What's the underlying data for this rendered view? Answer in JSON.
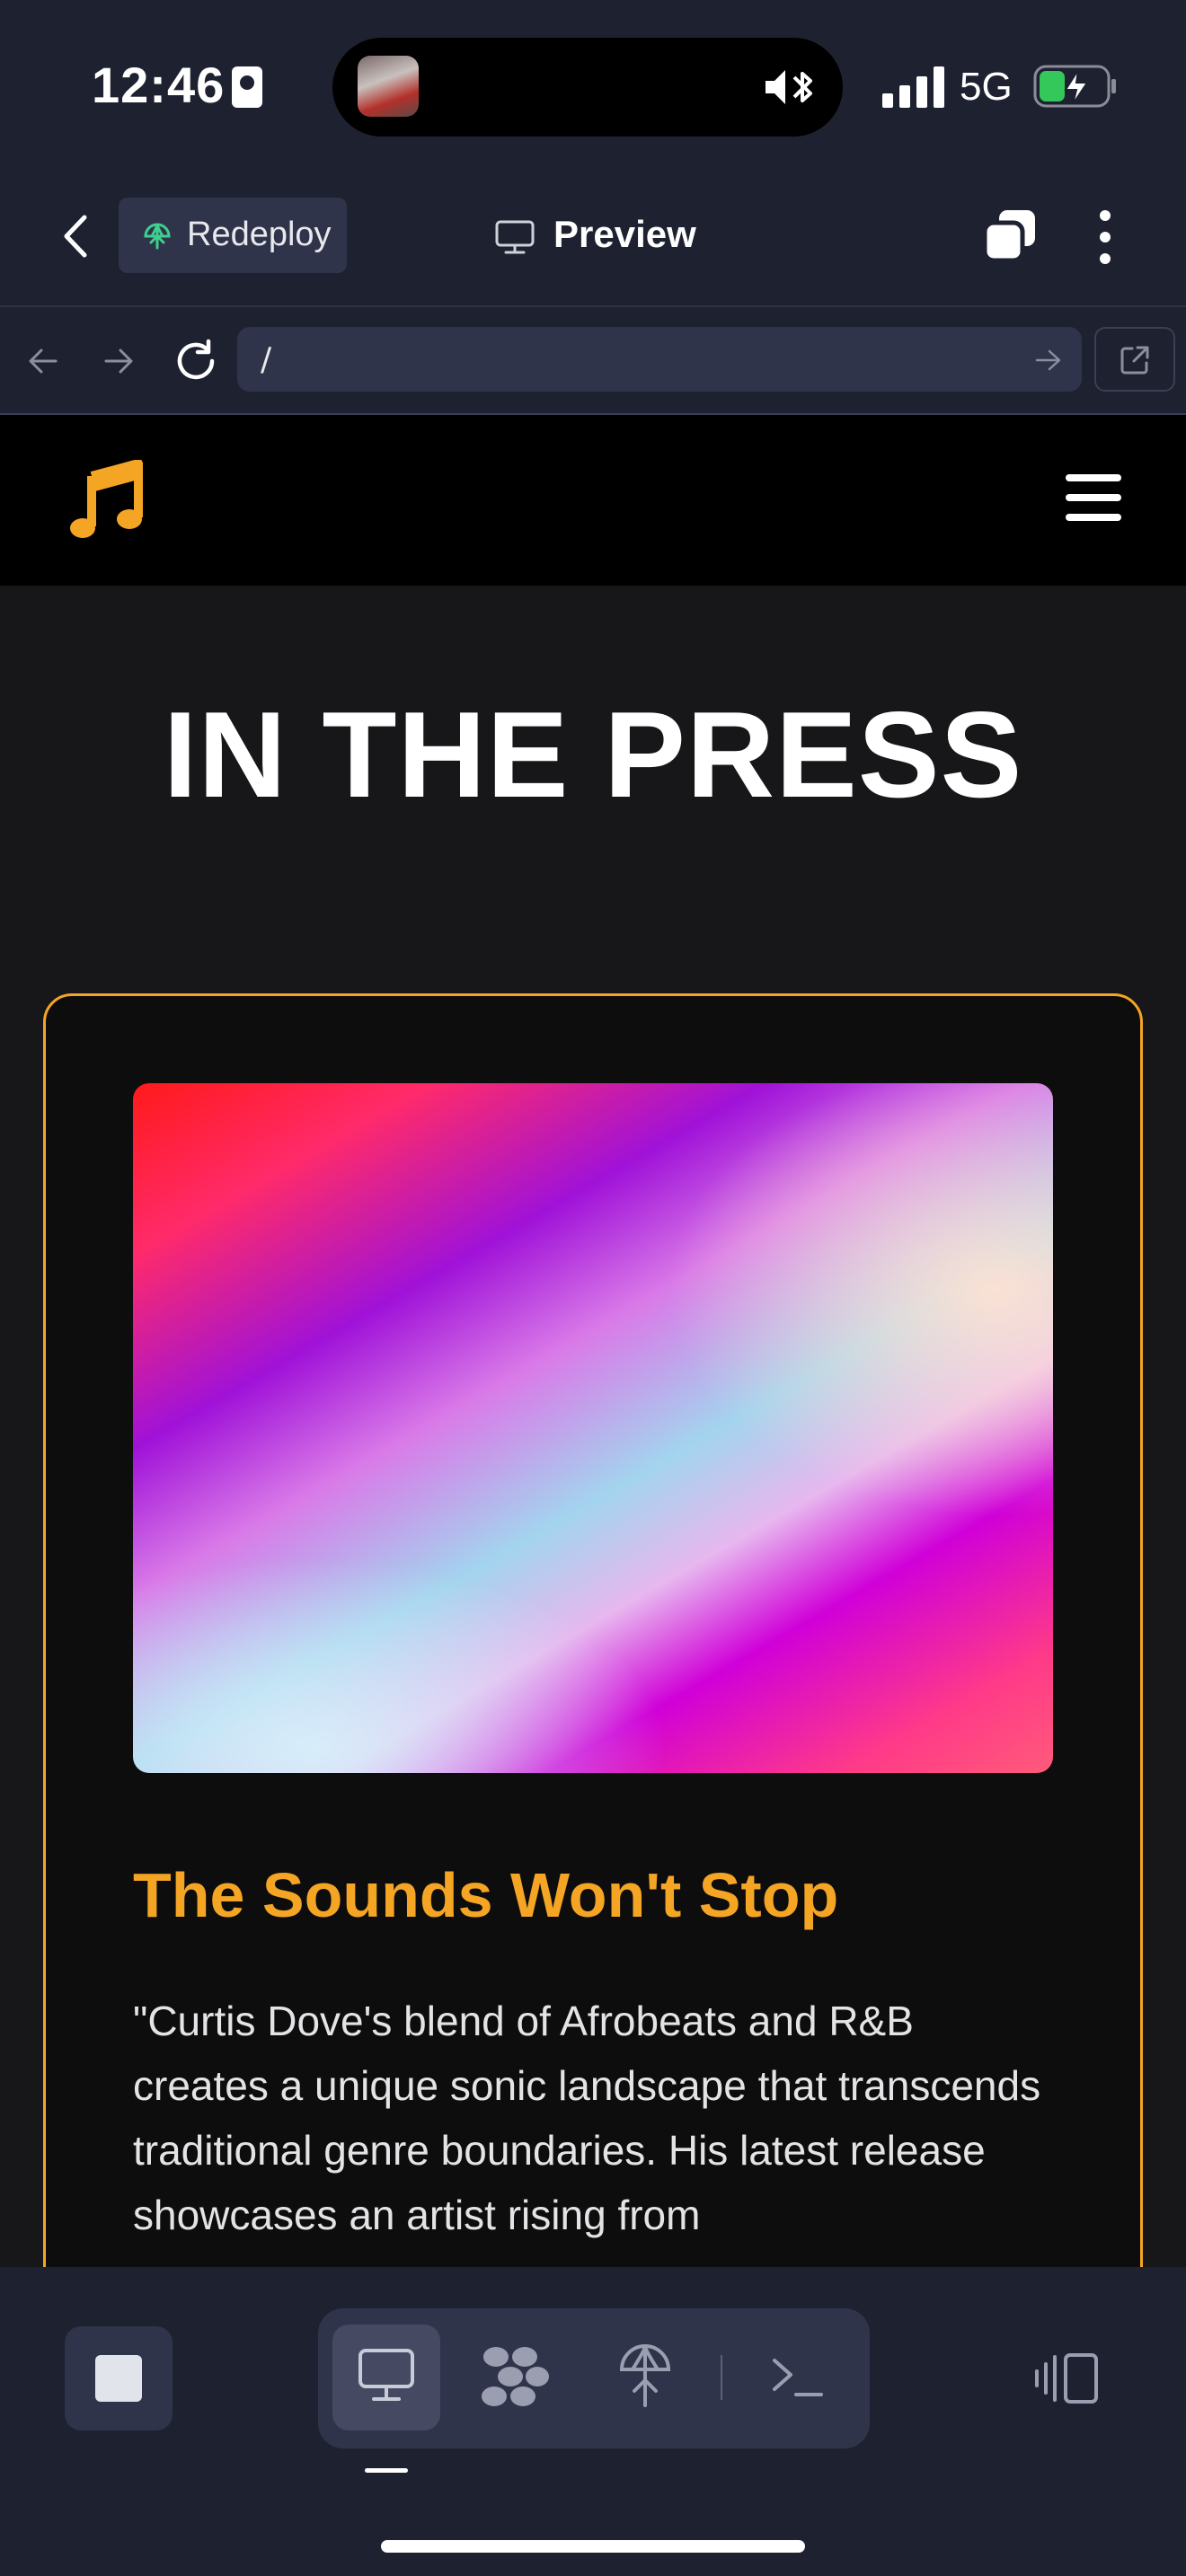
{
  "status_bar": {
    "time": "12:46",
    "network": "5G"
  },
  "header": {
    "redeploy_label": "Redeploy",
    "preview_label": "Preview"
  },
  "url_bar": {
    "path": "/"
  },
  "page": {
    "heading": "IN THE PRESS",
    "article": {
      "title": "The Sounds Won't Stop",
      "body": "\"Curtis Dove's blend of Afrobeats and R&B creates a unique sonic landscape that transcends traditional genre boundaries. His latest release showcases an artist rising from"
    }
  },
  "icons": {
    "logo": "music-note-icon",
    "menu": "hamburger-icon",
    "toolbar": [
      "stop-icon",
      "desktop-icon",
      "components-icon",
      "deploy-icon",
      "terminal-icon",
      "sidebar-toggle-icon"
    ]
  },
  "colors": {
    "accent": "#f5a524",
    "app_background": "#1e2130",
    "site_background": "#171719",
    "redeploy_icon": "#3ecf8e",
    "battery_charging": "#34c759"
  }
}
